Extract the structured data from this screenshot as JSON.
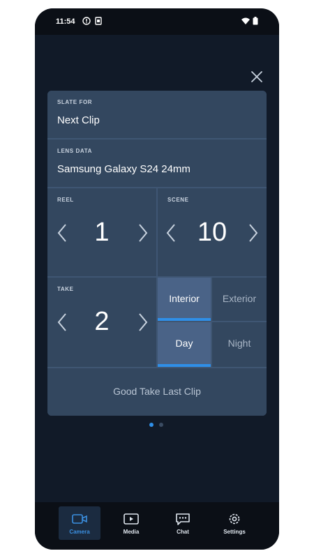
{
  "status_bar": {
    "time": "11:54"
  },
  "slate": {
    "slate_for_label": "SLATE FOR",
    "slate_for_value": "Next Clip",
    "lens_label": "LENS DATA",
    "lens_value": "Samsung Galaxy S24 24mm",
    "reel_label": "REEL",
    "reel_value": "1",
    "scene_label": "SCENE",
    "scene_value": "10",
    "take_label": "TAKE",
    "take_value": "2",
    "location_options": [
      "Interior",
      "Exterior"
    ],
    "location_selected": "Interior",
    "time_options": [
      "Day",
      "Night"
    ],
    "time_selected": "Day",
    "good_take_label": "Good Take Last Clip"
  },
  "pager": {
    "page_count": 2,
    "current_page": 1
  },
  "bottom_nav": {
    "items": [
      {
        "label": "Camera",
        "icon": "camera-icon",
        "active": true
      },
      {
        "label": "Media",
        "icon": "media-icon",
        "active": false
      },
      {
        "label": "Chat",
        "icon": "chat-icon",
        "active": false
      },
      {
        "label": "Settings",
        "icon": "settings-icon",
        "active": false
      }
    ]
  },
  "colors": {
    "background": "#111a28",
    "cell": "#33475f",
    "active_toggle": "#4a6387",
    "accent": "#2f8fe8"
  }
}
